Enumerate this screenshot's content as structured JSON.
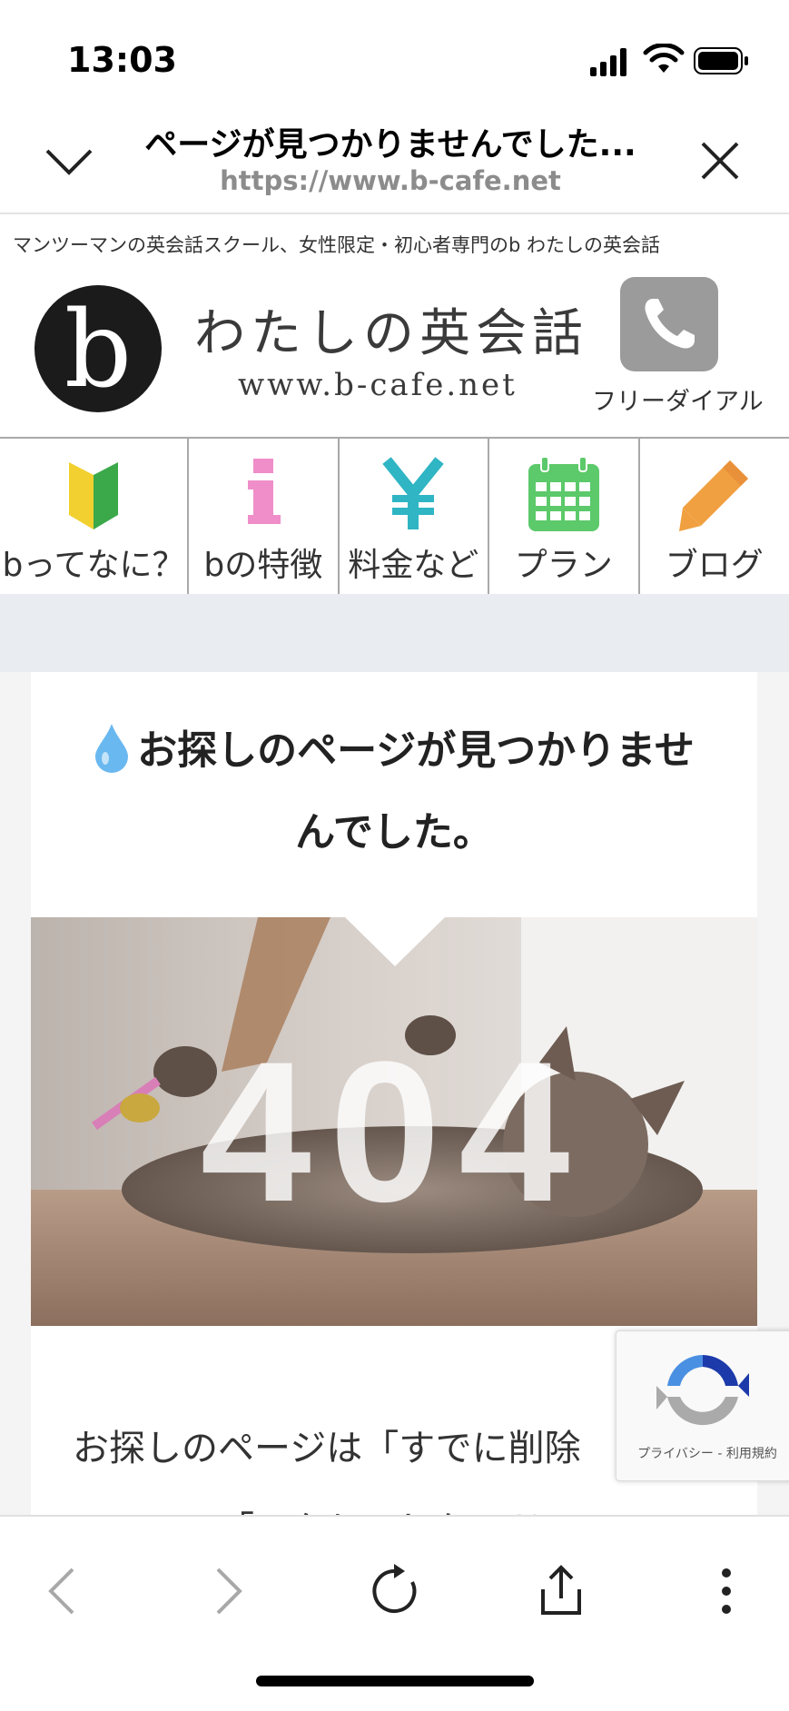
{
  "status_bar": {
    "time": "13:03"
  },
  "browser": {
    "page_title": "ページが見つかりませんでした...",
    "url": "https://www.b-cafe.net"
  },
  "site": {
    "tagline": "マンツーマンの英会話スクール、女性限定・初心者専門のb わたしの英会話",
    "logo_letter": "b",
    "logo_name": "わたしの英会話",
    "logo_url": "www.b-cafe.net",
    "free_dial_label": "フリーダイアル"
  },
  "nav": {
    "items": [
      {
        "label": "bってなに？",
        "icon": "beginner-mark-icon"
      },
      {
        "label": "bの特徴",
        "icon": "info-icon"
      },
      {
        "label": "料金など",
        "icon": "yen-icon"
      },
      {
        "label": "プラン",
        "icon": "calendar-icon"
      },
      {
        "label": "ブログ",
        "icon": "pencil-icon"
      }
    ]
  },
  "content": {
    "heading_line1": "お探しのページが見つかりませ",
    "heading_line2": "んでした。",
    "image_text": "404",
    "body_line1": "お探しのページは「すでに削除",
    "body_line2": "ている」、「アクセスしたアドレス"
  },
  "recaptcha": {
    "links": "プライバシー - 利用規約"
  },
  "colors": {
    "nav_yellow": "#f2d02f",
    "nav_green": "#3ba84a",
    "nav_pink": "#ef8ec9",
    "nav_teal": "#2fb5c4",
    "nav_calendar": "#5cc96a",
    "nav_orange": "#f0a040",
    "drop_blue": "#6ab8f0"
  }
}
